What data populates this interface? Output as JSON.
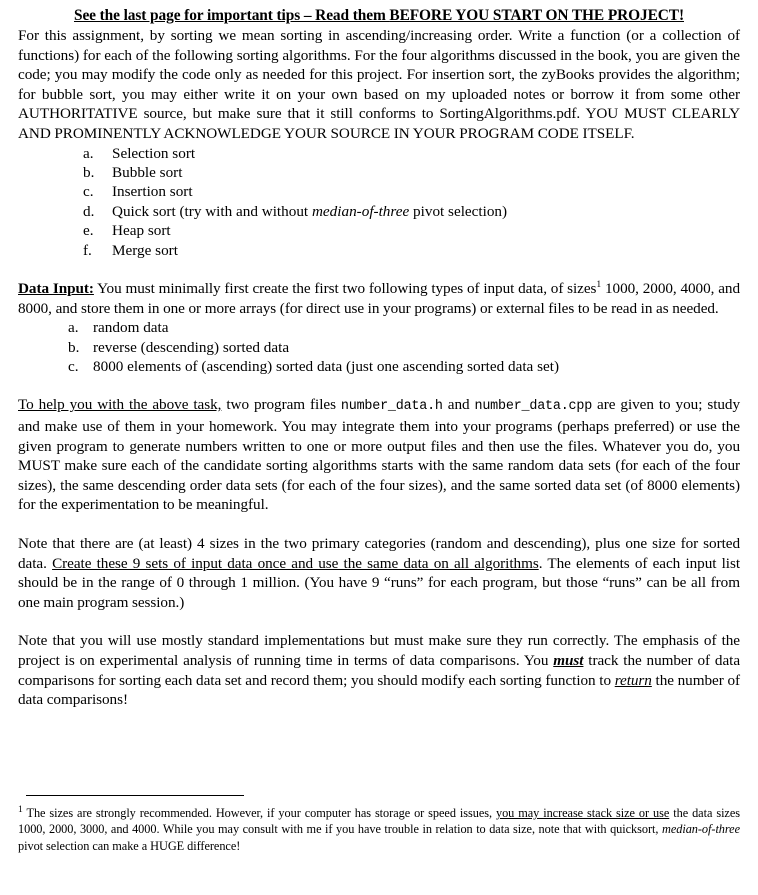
{
  "document": {
    "heading": {
      "part1": "See the last page for important tips – Read them ",
      "part2": "BEFORE YOU START ON THE PROJECT!"
    },
    "intro_paragraph": {
      "text": "For this assignment, by sorting we mean sorting in ascending/increasing order.  Write a function (or a collection of functions) for each of the following sorting algorithms.  For the four algorithms discussed in the book, you are given the code; you may modify the code only as needed for this project.  For insertion sort, the zyBooks provides the algorithm; for bubble sort, you may either write it on your own based on my uploaded notes or borrow it from some other AUTHORITATIVE source, but make sure that it still conforms to SortingAlgorithms.pdf.   YOU MUST CLEARLY AND PROMINENTLY ACKNOWLEDGE YOUR SOURCE IN YOUR PROGRAM CODE ITSELF."
    },
    "algorithm_list": [
      {
        "marker": "a.",
        "text": "Selection sort"
      },
      {
        "marker": "b.",
        "text": "Bubble sort"
      },
      {
        "marker": "c.",
        "text": "Insertion sort"
      },
      {
        "marker": "d.",
        "pre": "Quick sort (try with and without ",
        "em": "median-of-three",
        "post": " pivot selection)"
      },
      {
        "marker": "e.",
        "text": "Heap sort"
      },
      {
        "marker": "f.",
        "text": "Merge sort"
      }
    ],
    "data_input": {
      "label": "Data Input:",
      "text_before_footnote": " You must minimally first create the first two following types of input data, of sizes",
      "footnote_marker": "1",
      "text_after_footnote": " 1000, 2000, 4000, and 8000, and store them in one or more arrays (for direct use in your programs) or external files to be read in as needed."
    },
    "data_input_list": [
      {
        "marker": "a.",
        "text": "random data"
      },
      {
        "marker": "b.",
        "text": "reverse (descending) sorted data"
      },
      {
        "marker": "c.",
        "text": "8000 elements of (ascending) sorted data (just one ascending sorted data set)"
      }
    ],
    "help_paragraph": {
      "underlined_lead": "To help you with the above task,",
      "text1": " two program files ",
      "file1": "number_data.h",
      "text2": " and ",
      "file2": "number_data.cpp",
      "text3": " are given to you; study and make use of them in your homework.  You may integrate them into your programs (perhaps preferred) or use the given program to generate numbers written to one or more output files and then use the files.  Whatever you do, you MUST make sure each of the candidate sorting algorithms starts with the same random data sets (for each of the four sizes), the same descending order data sets (for each of the four sizes), and the same sorted data set (of 8000 elements) for the experimentation to be meaningful."
    },
    "note_sizes_paragraph": {
      "text1": "Note that there are (at least) 4 sizes in the two primary categories (random and descending), plus one size for sorted data.  ",
      "underlined": "Create these 9 sets of input data once and use the same data on all algorithms",
      "text2": ". The elements of each input list should be in the range of 0 through 1 million.  (You have 9 “runs” for each program, but those “runs” can be all from one main program session.)"
    },
    "note_implementations_paragraph": {
      "text1": "Note that you will use mostly standard implementations but must make sure they run correctly.  The emphasis of the project is on experimental analysis of running time in terms of data comparisons.  You ",
      "must_word": "must",
      "text2": " track the number of data comparisons for sorting each data set and record them; you should modify each sorting function to ",
      "return_word": "return",
      "text3": " the number of data comparisons!"
    },
    "footnote": {
      "marker": "1",
      "text1": " The sizes are strongly recommended.  However, if your computer has storage or speed issues, ",
      "underlined": "you may increase stack size or use",
      "text2": " the data sizes 1000, 2000, 3000, and 4000.  While you may consult with me if you have trouble in relation to data size, note that with quicksort, ",
      "italic": "median-of-three",
      "text3": " pivot selection can make a HUGE difference!"
    }
  }
}
